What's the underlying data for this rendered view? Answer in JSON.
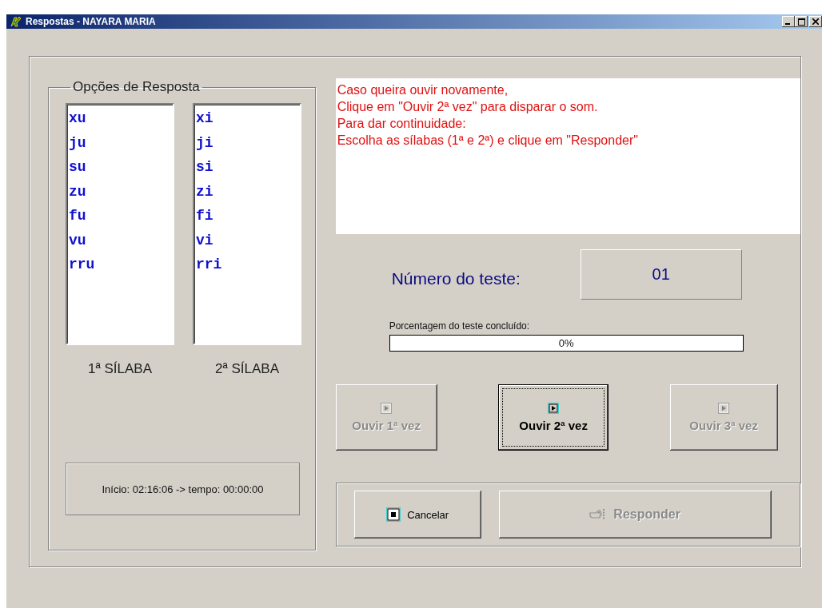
{
  "window": {
    "title": "Respostas - NAYARA MARIA"
  },
  "answer_options": {
    "title": "Opções de Resposta",
    "lists": [
      {
        "items": [
          "xu",
          "ju",
          "su",
          "zu",
          "fu",
          "vu",
          "rru"
        ],
        "caption": "1ª SÍLABA"
      },
      {
        "items": [
          "xi",
          "ji",
          "si",
          "zi",
          "fi",
          "vi",
          "rri"
        ],
        "caption": "2ª SÍLABA"
      }
    ]
  },
  "timer": "Início: 02:16:06 -> tempo: 00:00:00",
  "message": [
    "Caso queira ouvir novamente,",
    "Clique em \"Ouvir 2ª vez\" para disparar o som.",
    "Para dar continuidade:",
    "Escolha as sílabas (1ª e 2ª) e clique em \"Responder\""
  ],
  "test_number": {
    "label": "Número do teste:",
    "value": "01"
  },
  "progress": {
    "label": "Porcentagem do teste concluído:",
    "level": 0,
    "reading": "0%"
  },
  "play_buttons": [
    {
      "label": "Ouvir 1ª vez",
      "disabled": true,
      "focused": false
    },
    {
      "label": "Ouvir 2ª vez",
      "disabled": false,
      "focused": true
    },
    {
      "label": "Ouvir 3ª vez",
      "disabled": true,
      "focused": false
    }
  ],
  "actions": [
    {
      "label": "Cancelar",
      "kind": "cancel",
      "disabled": false
    },
    {
      "label": "Responder",
      "kind": "answer",
      "disabled": true
    }
  ]
}
